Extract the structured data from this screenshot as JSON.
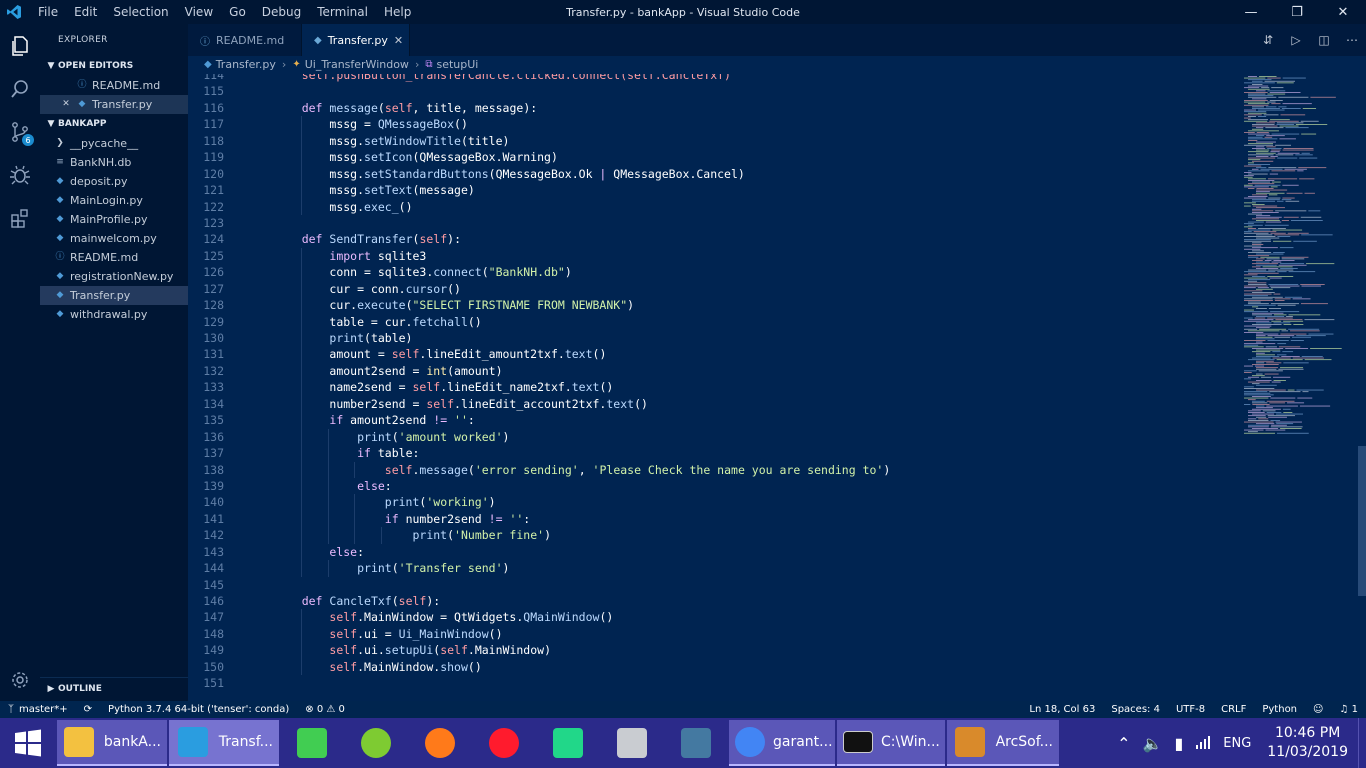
{
  "titlebar": {
    "menu": [
      "File",
      "Edit",
      "Selection",
      "View",
      "Go",
      "Debug",
      "Terminal",
      "Help"
    ],
    "title": "Transfer.py - bankApp - Visual Studio Code"
  },
  "activity": {
    "scm_badge": "6"
  },
  "sidebar": {
    "title": "EXPLORER",
    "open_editors_label": "OPEN EDITORS",
    "open_editors": [
      {
        "name": "README.md",
        "icon": "info-icon"
      },
      {
        "name": "Transfer.py",
        "icon": "python-icon"
      }
    ],
    "project_label": "BANKAPP",
    "files": [
      {
        "name": "__pycache__",
        "type": "folder"
      },
      {
        "name": "BankNH.db",
        "type": "db"
      },
      {
        "name": "deposit.py",
        "type": "py"
      },
      {
        "name": "MainLogin.py",
        "type": "py"
      },
      {
        "name": "MainProfile.py",
        "type": "py"
      },
      {
        "name": "mainwelcom.py",
        "type": "py"
      },
      {
        "name": "README.md",
        "type": "md"
      },
      {
        "name": "registrationNew.py",
        "type": "py"
      },
      {
        "name": "Transfer.py",
        "type": "py"
      },
      {
        "name": "withdrawal.py",
        "type": "py"
      }
    ],
    "outline_label": "OUTLINE"
  },
  "tabs": [
    {
      "label": "README.md"
    },
    {
      "label": "Transfer.py"
    }
  ],
  "breadcrumbs": [
    "Transfer.py",
    "Ui_TransferWindow",
    "setupUi"
  ],
  "code": [
    {
      "n": "114",
      "indent": 1,
      "tokens": [
        [
          "self",
          "self.pushButton_transferCancle.clicked.connect(self.CancleTxf)"
        ]
      ]
    },
    {
      "n": "115",
      "indent": 0,
      "tokens": []
    },
    {
      "n": "116",
      "indent": 1,
      "tokens": [
        [
          "kw",
          "def "
        ],
        [
          "fn",
          "message"
        ],
        [
          "",
          "("
        ],
        [
          "self",
          "self"
        ],
        [
          "",
          ", "
        ],
        [
          "",
          "title"
        ],
        [
          "",
          ", "
        ],
        [
          "",
          "message"
        ],
        [
          "",
          "):"
        ]
      ]
    },
    {
      "n": "117",
      "indent": 2,
      "tokens": [
        [
          "",
          "mssg = "
        ],
        [
          "fn",
          "QMessageBox"
        ],
        [
          "",
          "()"
        ]
      ]
    },
    {
      "n": "118",
      "indent": 2,
      "tokens": [
        [
          "",
          "mssg."
        ],
        [
          "fn",
          "setWindowTitle"
        ],
        [
          "",
          "(title)"
        ]
      ]
    },
    {
      "n": "119",
      "indent": 2,
      "tokens": [
        [
          "",
          "mssg."
        ],
        [
          "fn",
          "setIcon"
        ],
        [
          "",
          "(QMessageBox.Warning)"
        ]
      ]
    },
    {
      "n": "120",
      "indent": 2,
      "tokens": [
        [
          "",
          "mssg."
        ],
        [
          "fn",
          "setStandardButtons"
        ],
        [
          "",
          "(QMessageBox.Ok "
        ],
        [
          "kw",
          "| "
        ],
        [
          "",
          "QMessageBox.Cancel)"
        ]
      ]
    },
    {
      "n": "121",
      "indent": 2,
      "tokens": [
        [
          "",
          "mssg."
        ],
        [
          "fn",
          "setText"
        ],
        [
          "",
          "(message)"
        ]
      ]
    },
    {
      "n": "122",
      "indent": 2,
      "tokens": [
        [
          "",
          "mssg."
        ],
        [
          "fn",
          "exec_"
        ],
        [
          "",
          "()"
        ]
      ]
    },
    {
      "n": "123",
      "indent": 0,
      "tokens": []
    },
    {
      "n": "124",
      "indent": 1,
      "tokens": [
        [
          "kw",
          "def "
        ],
        [
          "fn",
          "SendTransfer"
        ],
        [
          "",
          "("
        ],
        [
          "self",
          "self"
        ],
        [
          "",
          "):"
        ]
      ]
    },
    {
      "n": "125",
      "indent": 2,
      "tokens": [
        [
          "kw",
          "import "
        ],
        [
          "",
          "sqlite3"
        ]
      ]
    },
    {
      "n": "126",
      "indent": 2,
      "tokens": [
        [
          "",
          "conn = sqlite3."
        ],
        [
          "fn",
          "connect"
        ],
        [
          "",
          "("
        ],
        [
          "str",
          "\"BankNH.db\""
        ],
        [
          "",
          ")"
        ]
      ]
    },
    {
      "n": "127",
      "indent": 2,
      "tokens": [
        [
          "",
          "cur = conn."
        ],
        [
          "fn",
          "cursor"
        ],
        [
          "",
          "()"
        ]
      ]
    },
    {
      "n": "128",
      "indent": 2,
      "tokens": [
        [
          "",
          "cur."
        ],
        [
          "fn",
          "execute"
        ],
        [
          "",
          "("
        ],
        [
          "str",
          "\"SELECT FIRSTNAME FROM NEWBANK\""
        ],
        [
          "",
          ")"
        ]
      ]
    },
    {
      "n": "129",
      "indent": 2,
      "tokens": [
        [
          "",
          "table = cur."
        ],
        [
          "fn",
          "fetchall"
        ],
        [
          "",
          "()"
        ]
      ]
    },
    {
      "n": "130",
      "indent": 2,
      "tokens": [
        [
          "fn",
          "print"
        ],
        [
          "",
          "(table)"
        ]
      ]
    },
    {
      "n": "131",
      "indent": 2,
      "tokens": [
        [
          "",
          "amount = "
        ],
        [
          "self",
          "self"
        ],
        [
          "",
          ".lineEdit_amount2txf."
        ],
        [
          "fn",
          "text"
        ],
        [
          "",
          "()"
        ]
      ]
    },
    {
      "n": "132",
      "indent": 2,
      "tokens": [
        [
          "",
          "amount2send = "
        ],
        [
          "cls",
          "int"
        ],
        [
          "",
          "(amount)"
        ]
      ]
    },
    {
      "n": "133",
      "indent": 2,
      "tokens": [
        [
          "",
          "name2send = "
        ],
        [
          "self",
          "self"
        ],
        [
          "",
          ".lineEdit_name2txf."
        ],
        [
          "fn",
          "text"
        ],
        [
          "",
          "()"
        ]
      ]
    },
    {
      "n": "134",
      "indent": 2,
      "tokens": [
        [
          "",
          "number2send = "
        ],
        [
          "self",
          "self"
        ],
        [
          "",
          ".lineEdit_account2txf."
        ],
        [
          "fn",
          "text"
        ],
        [
          "",
          "()"
        ]
      ]
    },
    {
      "n": "135",
      "indent": 2,
      "tokens": [
        [
          "kw",
          "if "
        ],
        [
          "",
          "amount2send "
        ],
        [
          "kw",
          "!= "
        ],
        [
          "str",
          "''"
        ],
        [
          "",
          ":"
        ]
      ]
    },
    {
      "n": "136",
      "indent": 3,
      "tokens": [
        [
          "fn",
          "print"
        ],
        [
          "",
          "("
        ],
        [
          "str",
          "'amount worked'"
        ],
        [
          "",
          ")"
        ]
      ]
    },
    {
      "n": "137",
      "indent": 3,
      "tokens": [
        [
          "kw",
          "if "
        ],
        [
          "",
          "table:"
        ]
      ]
    },
    {
      "n": "138",
      "indent": 4,
      "tokens": [
        [
          "self",
          "self"
        ],
        [
          "",
          "."
        ],
        [
          "fn",
          "message"
        ],
        [
          "",
          "("
        ],
        [
          "str",
          "'error sending'"
        ],
        [
          "",
          ", "
        ],
        [
          "str",
          "'Please Check the name you are sending to'"
        ],
        [
          "",
          ")"
        ]
      ]
    },
    {
      "n": "139",
      "indent": 3,
      "tokens": [
        [
          "kw",
          "else"
        ],
        [
          "",
          ":"
        ]
      ]
    },
    {
      "n": "140",
      "indent": 4,
      "tokens": [
        [
          "fn",
          "print"
        ],
        [
          "",
          "("
        ],
        [
          "str",
          "'working'"
        ],
        [
          "",
          ")"
        ]
      ]
    },
    {
      "n": "141",
      "indent": 4,
      "tokens": [
        [
          "kw",
          "if "
        ],
        [
          "",
          "number2send "
        ],
        [
          "kw",
          "!= "
        ],
        [
          "str",
          "''"
        ],
        [
          "",
          ":"
        ]
      ]
    },
    {
      "n": "142",
      "indent": 5,
      "tokens": [
        [
          "fn",
          "print"
        ],
        [
          "",
          "("
        ],
        [
          "str",
          "'Number fine'"
        ],
        [
          "",
          ")"
        ]
      ]
    },
    {
      "n": "143",
      "indent": 2,
      "tokens": [
        [
          "kw",
          "else"
        ],
        [
          "",
          ":"
        ]
      ]
    },
    {
      "n": "144",
      "indent": 3,
      "tokens": [
        [
          "fn",
          "print"
        ],
        [
          "",
          "("
        ],
        [
          "str",
          "'Transfer send'"
        ],
        [
          "",
          ")"
        ]
      ]
    },
    {
      "n": "145",
      "indent": 0,
      "tokens": []
    },
    {
      "n": "146",
      "indent": 1,
      "tokens": [
        [
          "kw",
          "def "
        ],
        [
          "fn",
          "CancleTxf"
        ],
        [
          "",
          "("
        ],
        [
          "self",
          "self"
        ],
        [
          "",
          "):"
        ]
      ]
    },
    {
      "n": "147",
      "indent": 2,
      "tokens": [
        [
          "self",
          "self"
        ],
        [
          "",
          ".MainWindow = QtWidgets."
        ],
        [
          "fn",
          "QMainWindow"
        ],
        [
          "",
          "()"
        ]
      ]
    },
    {
      "n": "148",
      "indent": 2,
      "tokens": [
        [
          "self",
          "self"
        ],
        [
          "",
          ".ui = "
        ],
        [
          "fn",
          "Ui_MainWindow"
        ],
        [
          "",
          "()"
        ]
      ]
    },
    {
      "n": "149",
      "indent": 2,
      "tokens": [
        [
          "self",
          "self"
        ],
        [
          "",
          ".ui."
        ],
        [
          "fn",
          "setupUi"
        ],
        [
          "",
          "("
        ],
        [
          "self",
          "self"
        ],
        [
          "",
          ".MainWindow)"
        ]
      ]
    },
    {
      "n": "150",
      "indent": 2,
      "tokens": [
        [
          "self",
          "self"
        ],
        [
          "",
          ".MainWindow."
        ],
        [
          "fn",
          "show"
        ],
        [
          "",
          "()"
        ]
      ]
    },
    {
      "n": "151",
      "indent": 0,
      "tokens": []
    }
  ],
  "status": {
    "branch": "master*+",
    "interpreter": "Python 3.7.4 64-bit ('tenser': conda)",
    "errors": "0",
    "warnings": "0",
    "position": "Ln 18, Col 63",
    "spaces": "Spaces: 4",
    "encoding": "UTF-8",
    "eol": "CRLF",
    "language": "Python",
    "notifications": "1"
  },
  "taskbar": {
    "apps": [
      {
        "label": "bankA...",
        "icon": "folder-icon",
        "state": "open"
      },
      {
        "label": "Transf...",
        "icon": "vscode-icon",
        "state": "active"
      },
      {
        "label": "",
        "icon": "qt-icon",
        "state": "pinned"
      },
      {
        "label": "",
        "icon": "gitkraken-icon",
        "state": "pinned"
      },
      {
        "label": "",
        "icon": "firefox-icon",
        "state": "pinned"
      },
      {
        "label": "",
        "icon": "opera-icon",
        "state": "pinned"
      },
      {
        "label": "",
        "icon": "pycharm-icon",
        "state": "pinned"
      },
      {
        "label": "",
        "icon": "database-icon",
        "state": "pinned"
      },
      {
        "label": "",
        "icon": "mysql-icon",
        "state": "pinned"
      },
      {
        "label": "garant...",
        "icon": "chrome-icon",
        "state": "open"
      },
      {
        "label": "C:\\Win...",
        "icon": "cmd-icon",
        "state": "open"
      },
      {
        "label": "ArcSof...",
        "icon": "arcsoft-icon",
        "state": "open"
      }
    ],
    "language": "ENG",
    "time": "10:46 PM",
    "date": "11/03/2019"
  }
}
